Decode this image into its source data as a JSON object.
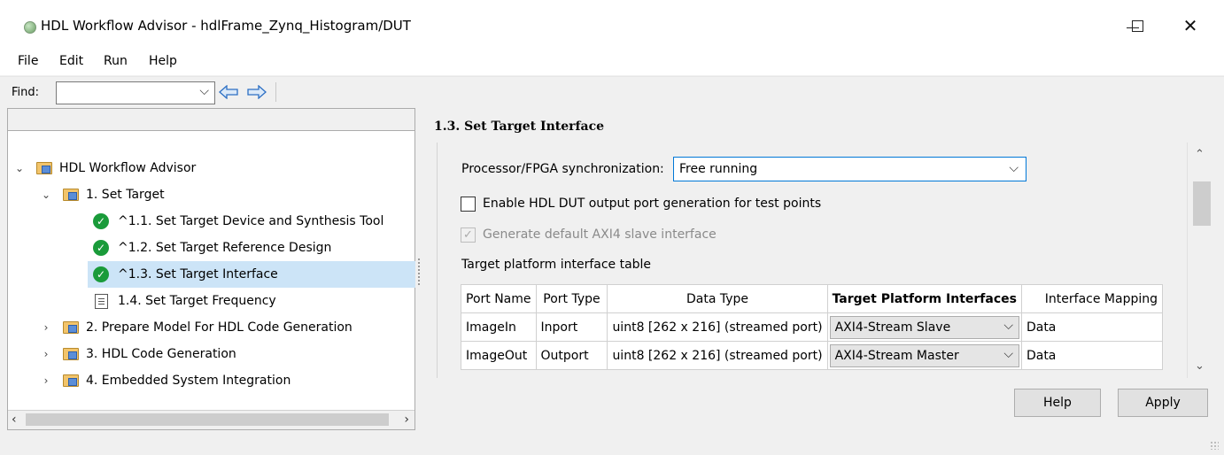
{
  "window": {
    "title": "HDL Workflow Advisor - hdlFrame_Zynq_Histogram/DUT",
    "minimize_glyph": "—",
    "maximize_glyph": "☐",
    "close_glyph": "✕"
  },
  "menu": {
    "items": [
      "File",
      "Edit",
      "Run",
      "Help"
    ]
  },
  "find": {
    "label": "Find:",
    "value": ""
  },
  "tree": {
    "items": [
      {
        "label": "HDL Workflow Advisor",
        "expander": "⌄",
        "icon": "folder-icon"
      },
      {
        "label": "1. Set Target",
        "expander": "⌄",
        "icon": "folder-icon"
      },
      {
        "label": "^1.1. Set Target Device and Synthesis Tool",
        "icon": "check-icon"
      },
      {
        "label": "^1.2. Set Target Reference Design",
        "icon": "check-icon"
      },
      {
        "label": "^1.3. Set Target Interface",
        "icon": "check-icon",
        "selected": true
      },
      {
        "label": "1.4. Set Target Frequency",
        "icon": "doc-icon"
      },
      {
        "label": "2. Prepare Model For HDL Code Generation",
        "expander": "›",
        "icon": "folder-icon"
      },
      {
        "label": "3. HDL Code Generation",
        "expander": "›",
        "icon": "folder-icon"
      },
      {
        "label": "4. Embedded System Integration",
        "expander": "›",
        "icon": "folder-icon"
      }
    ]
  },
  "panel": {
    "title": "1.3. Set Target Interface",
    "sync_label": "Processor/FPGA synchronization:",
    "sync_value": "Free running",
    "checkbox_test_points": {
      "label": "Enable HDL DUT output port generation for test points",
      "checked": false
    },
    "checkbox_axi4": {
      "label": "Generate default AXI4 slave interface",
      "checked": true,
      "disabled": true
    },
    "table_label": "Target platform interface table",
    "table": {
      "headers": [
        "Port Name",
        "Port Type",
        "Data Type",
        "Target Platform Interfaces",
        "Interface Mapping"
      ],
      "rows": [
        {
          "port_name": "ImageIn",
          "port_type": "Inport",
          "data_type": "uint8 [262 x 216] (streamed port)",
          "interface": "AXI4-Stream Slave",
          "mapping": "Data"
        },
        {
          "port_name": "ImageOut",
          "port_type": "Outport",
          "data_type": "uint8 [262 x 216] (streamed port)",
          "interface": "AXI4-Stream Master",
          "mapping": "Data"
        }
      ]
    }
  },
  "buttons": {
    "help": "Help",
    "apply": "Apply"
  },
  "colors": {
    "selection": "#cce4f7",
    "focus_border": "#0078d7",
    "status_ok": "#1a9b3a"
  }
}
